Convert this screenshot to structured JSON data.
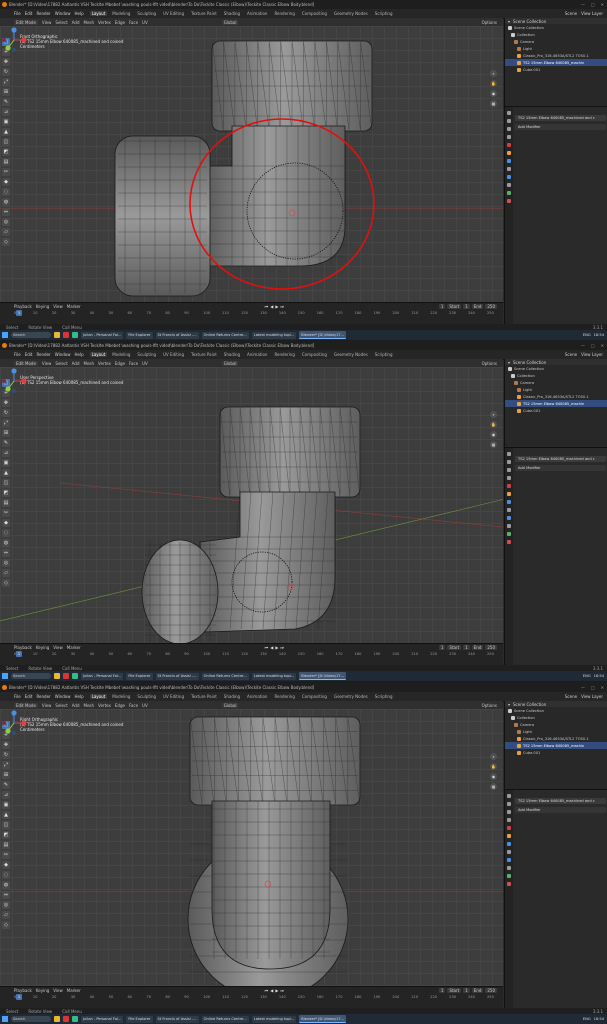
{
  "app": {
    "title": "Blender* [D:\\Video\\17882 Aatlantis VSH Tecklte Mbebet \\washing pouls-lfit vided\\blender\\To Do\\Teckite Classic (Elbow)\\Teckite Classic Elbow Body.blend]",
    "window_controls": [
      "—",
      "□",
      "✕"
    ]
  },
  "menu": [
    "File",
    "Edit",
    "Render",
    "Window",
    "Help"
  ],
  "workspaces": [
    "Layout",
    "Modeling",
    "Sculpting",
    "UV Editing",
    "Texture Paint",
    "Shading",
    "Animation",
    "Rendering",
    "Compositing",
    "Geometry Nodes",
    "Scripting"
  ],
  "topbar_right": [
    "Scene",
    "View Layer"
  ],
  "tool_header": {
    "mode": "Edit Mode",
    "menus": [
      "View",
      "Select",
      "Add",
      "Mesh",
      "Vertex",
      "Edge",
      "Face",
      "UV"
    ],
    "transform": "Global",
    "options": "Options"
  },
  "panels": [
    {
      "view_name": "Front Orthographic",
      "object_line": "(1) TS2 15mm Elbow 640085_machined and coined",
      "units": "Centimeters"
    },
    {
      "view_name": "User Perspective",
      "object_line": "(1) TS2 15mm Elbow 640085_machined and coined",
      "units": ""
    },
    {
      "view_name": "Right Orthographic",
      "object_line": "(1) TS2 15mm Elbow 640085_machined and coined",
      "units": "Centimeters"
    }
  ],
  "outliner": {
    "header": "Scene Collection",
    "rows": [
      {
        "label": "Scene Collection",
        "selected": false,
        "icon_color": "#cccccc"
      },
      {
        "label": "Collection",
        "selected": false,
        "icon_color": "#cccccc"
      },
      {
        "label": "Camera",
        "selected": false,
        "icon_color": "#b07a4a"
      },
      {
        "label": "Light",
        "selected": false,
        "icon_color": "#b07a4a"
      },
      {
        "label": "Classic_Pro_316-4653A/STL2 TOS0-1",
        "selected": false,
        "icon_color": "#e8a040"
      },
      {
        "label": "TS2 15mm Elbow 640085_machin",
        "selected": true,
        "icon_color": "#e8a040"
      },
      {
        "label": "Cube.001",
        "selected": false,
        "icon_color": "#e8a040"
      }
    ]
  },
  "properties": {
    "object_name": "TS2 15mm Elbow 640085_machined and c",
    "add_modifier": "Add Modifier"
  },
  "timeline": {
    "menus": [
      "Playback",
      "Keying",
      "View",
      "Marker"
    ],
    "current_frame": "1",
    "start_label": "Start",
    "start": "1",
    "end_label": "End",
    "end": "250",
    "ticks": [
      "0",
      "10",
      "20",
      "30",
      "40",
      "50",
      "60",
      "70",
      "80",
      "90",
      "100",
      "110",
      "120",
      "130",
      "140",
      "150",
      "160",
      "170",
      "180",
      "190",
      "200",
      "210",
      "220",
      "230",
      "240",
      "250"
    ]
  },
  "statusbar": {
    "items": [
      "Select",
      "Rotate View",
      "Call Menu"
    ],
    "version": "3.3.1"
  },
  "taskbar": {
    "search": "Search",
    "apps": [
      {
        "label": "Julian - Personal Fol...",
        "active": false
      },
      {
        "label": "File Explorer",
        "active": false
      },
      {
        "label": "St Francis of Assisi -...",
        "active": false
      },
      {
        "label": "Online Returns Centre...",
        "active": false
      },
      {
        "label": "Latest modeling topi...",
        "active": false
      },
      {
        "label": "Blender* [D:\\Video\\17...",
        "active": true
      }
    ],
    "tray": [
      "ENG",
      "18:54"
    ]
  },
  "annotations": {
    "circle_color": "#e01010"
  }
}
